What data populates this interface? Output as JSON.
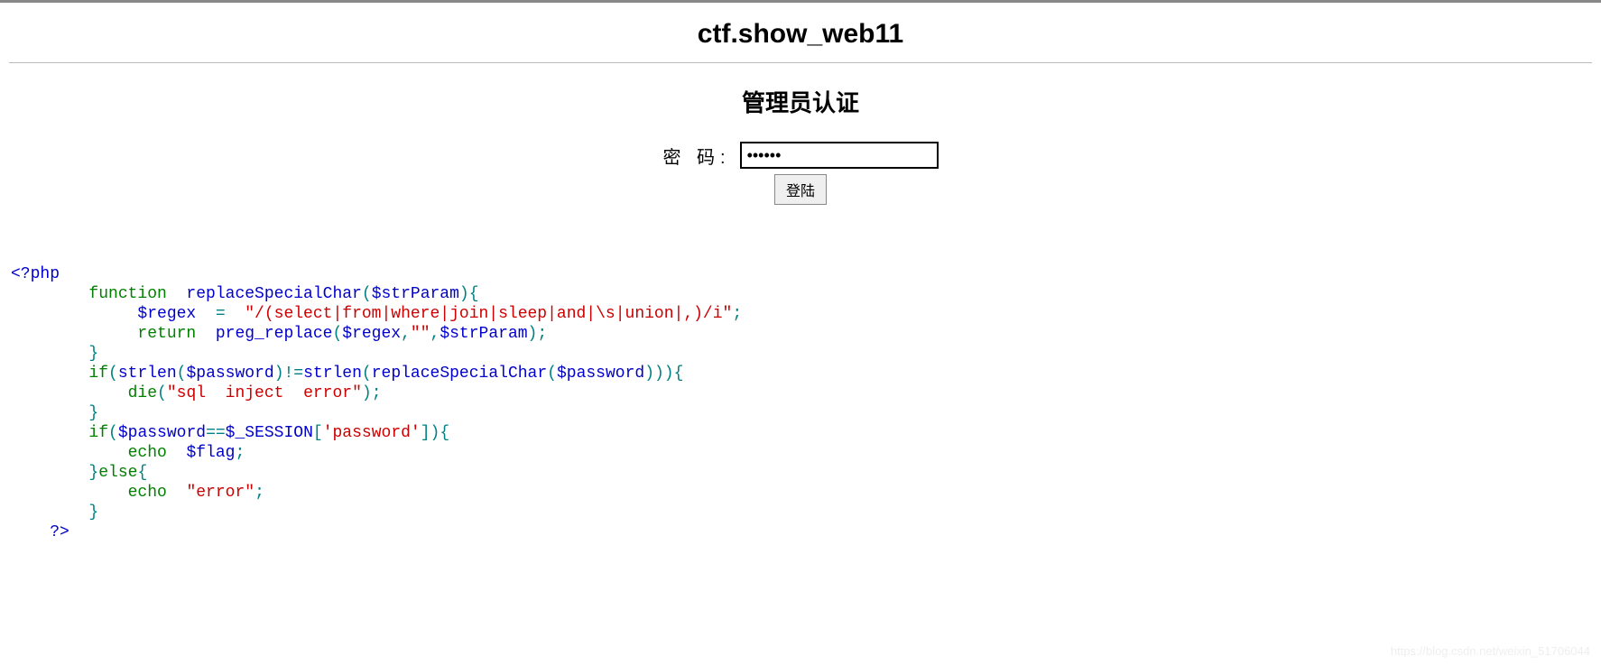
{
  "header": {
    "title": "ctf.show_web11"
  },
  "auth": {
    "title": "管理员认证",
    "password_label": "密  码:",
    "password_value": "••••••",
    "login_label": "登陆"
  },
  "code": {
    "php_open": "<?php",
    "l1_fn": "        function",
    "l1_name": "  replaceSpecialChar",
    "l1_paren1": "(",
    "l1_param": "$strParam",
    "l1_paren2": "){",
    "l2_var": "             $regex",
    "l2_eq": "  =  ",
    "l2_str": "\"/(select|from|where|join|sleep|and|\\s|union|,)/i\"",
    "l2_semi": ";",
    "l3_ret": "             return",
    "l3_fn": "  preg_replace",
    "l3_paren1": "(",
    "l3_a1": "$regex",
    "l3_c1": ",",
    "l3_a2": "\"\"",
    "l3_c2": ",",
    "l3_a3": "$strParam",
    "l3_paren2": ");",
    "l4_brace": "        }",
    "l5_if": "        if",
    "l5_p1": "(",
    "l5_fn1": "strlen",
    "l5_p2": "(",
    "l5_v1": "$password",
    "l5_p3": ")!=",
    "l5_fn2": "strlen",
    "l5_p4": "(",
    "l5_fn3": "replaceSpecialChar",
    "l5_p5": "(",
    "l5_v2": "$password",
    "l5_p6": "))){",
    "l6_die": "            die",
    "l6_p1": "(",
    "l6_str": "\"sql  inject  error\"",
    "l6_p2": ");",
    "l7_brace": "        }",
    "l8_if": "        if",
    "l8_p1": "(",
    "l8_v1": "$password",
    "l8_eq": "==",
    "l8_v2": "$_SESSION",
    "l8_b1": "[",
    "l8_key": "'password'",
    "l8_b2": "]){",
    "l9_echo": "            echo",
    "l9_sp": "  ",
    "l9_var": "$flag",
    "l9_semi": ";",
    "l10_brace": "        }",
    "l10_else": "else",
    "l10_open": "{",
    "l11_echo": "            echo",
    "l11_sp1": "  ",
    "l11_str": "\"error\"",
    "l11_semi": ";",
    "l12_brace": "        }",
    "php_close": "    ?>"
  },
  "watermark": "https://blog.csdn.net/weixin_51706044"
}
